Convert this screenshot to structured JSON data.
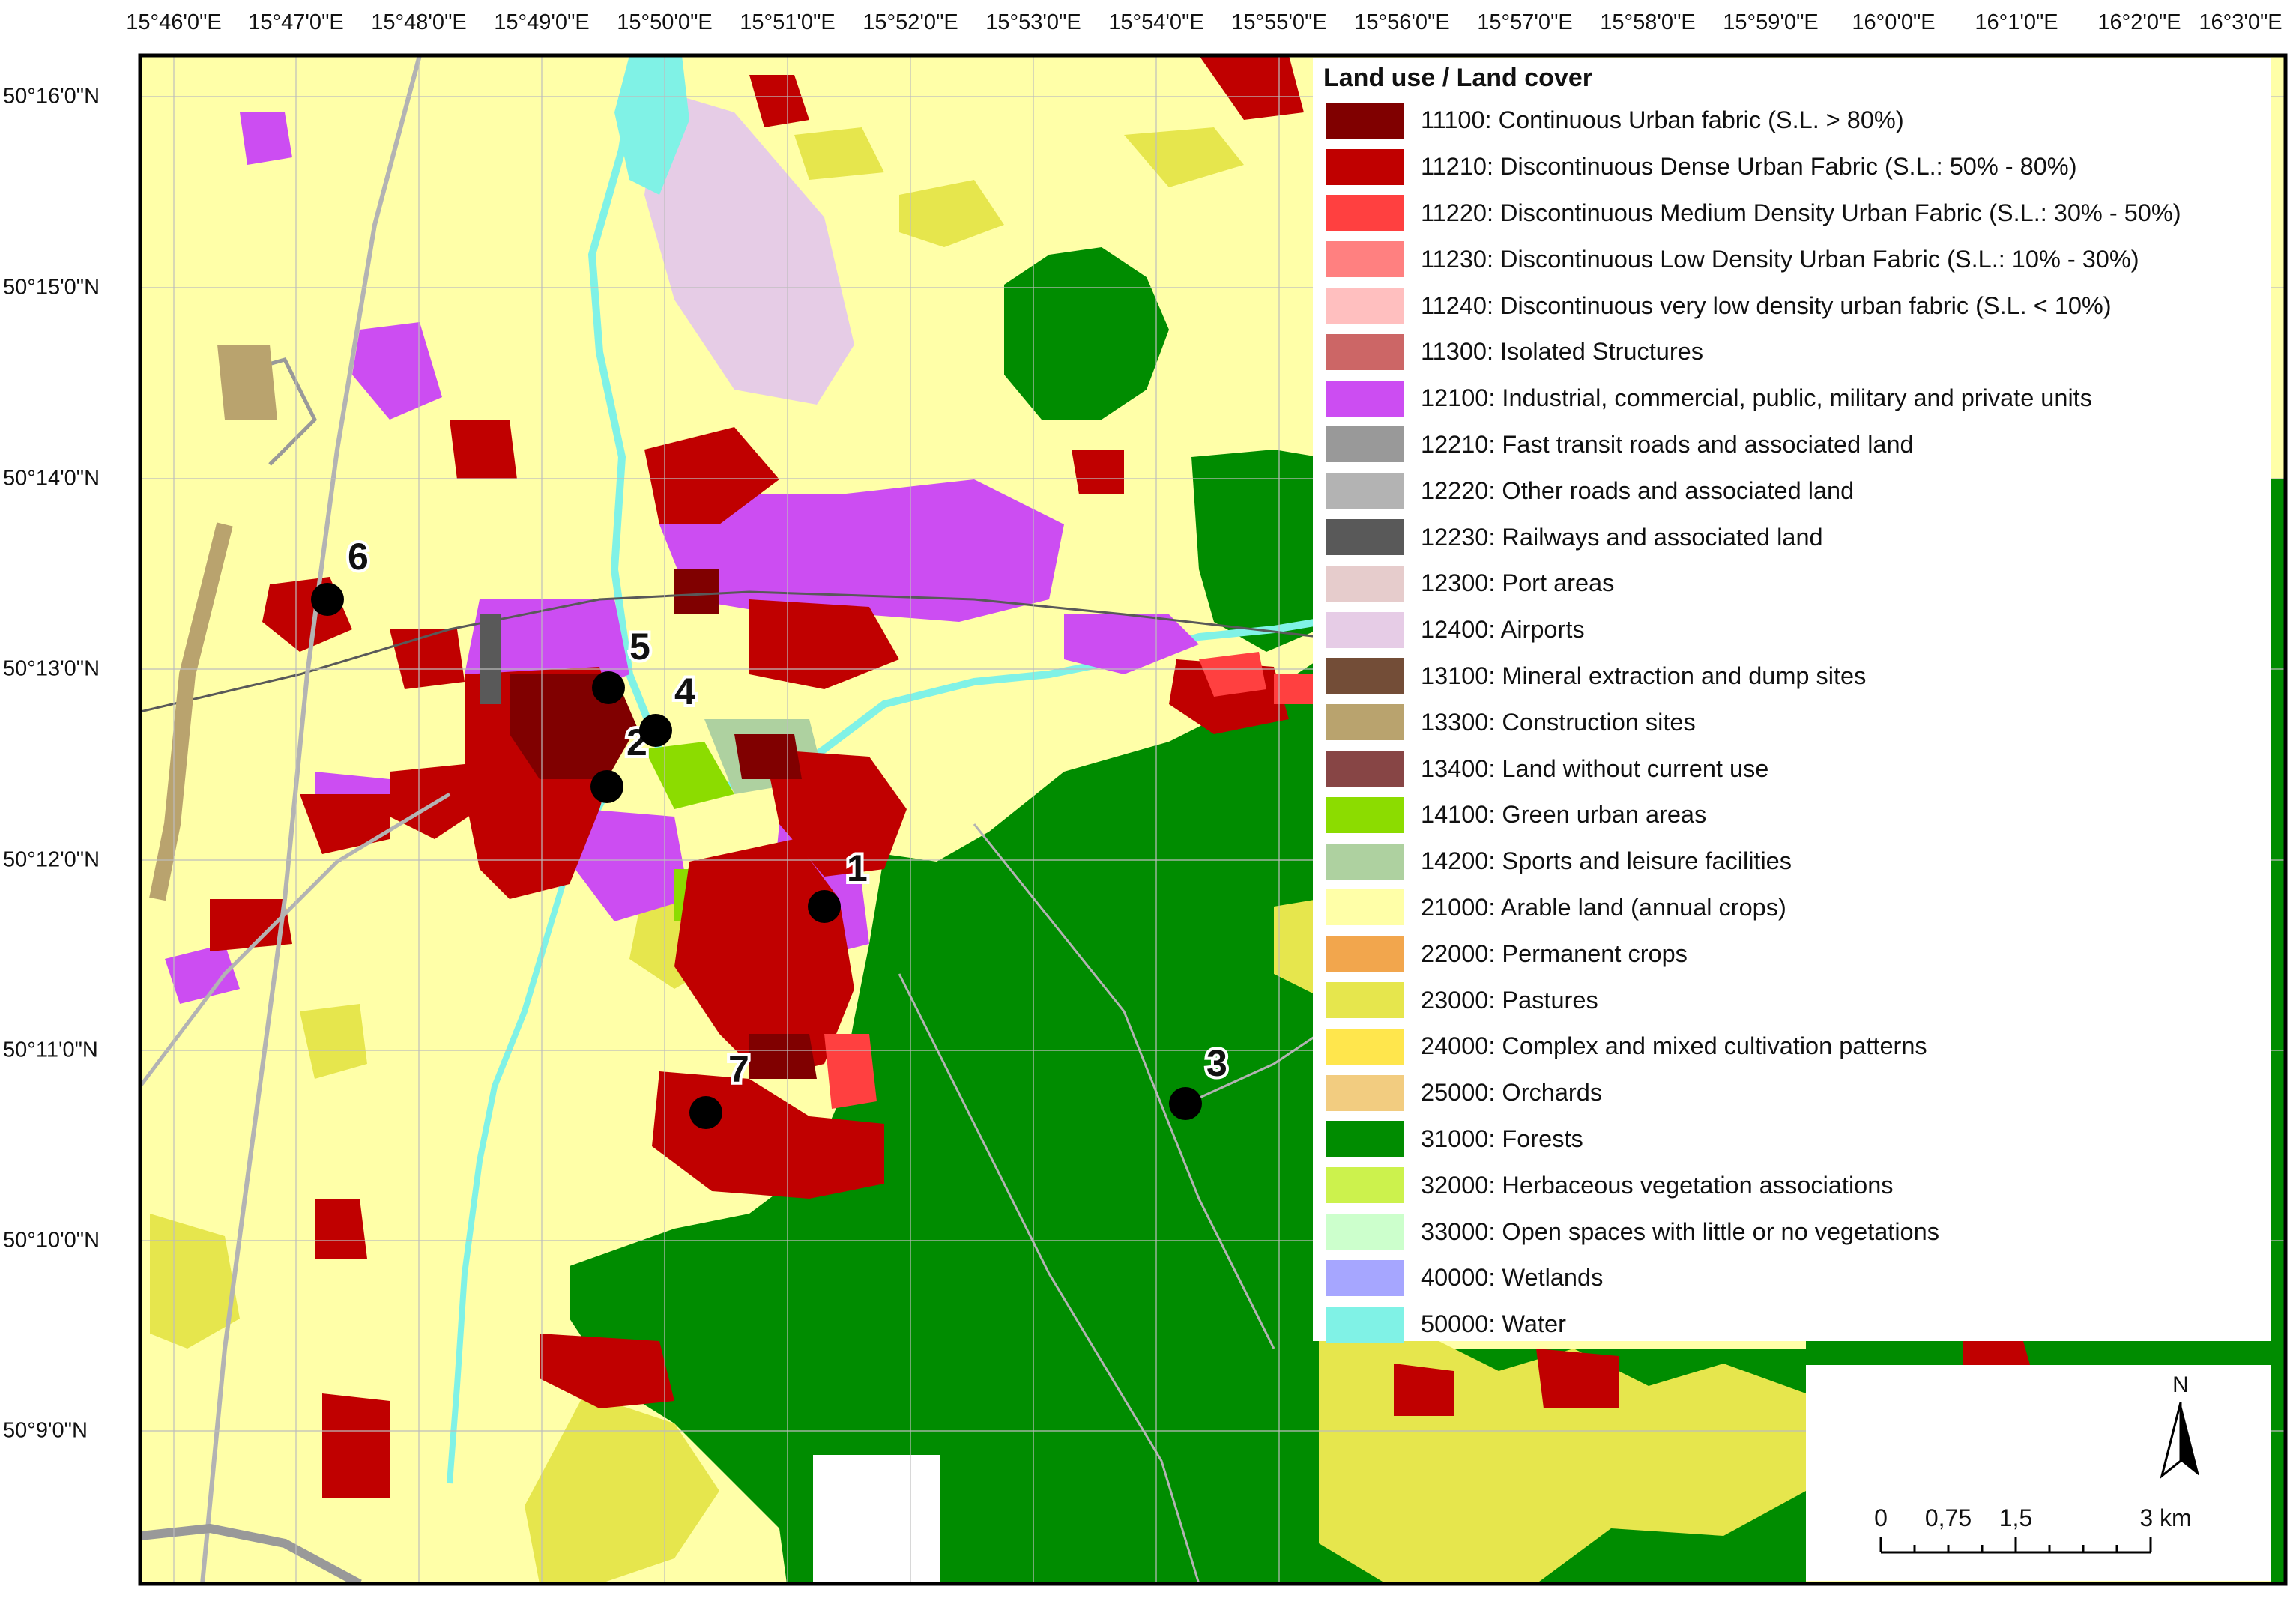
{
  "colors": {
    "arable": "#ffffa8",
    "forest": "#008c00",
    "continuous_urban": "#800000",
    "dense_urban": "#c00000",
    "medium_urban": "#ff4040",
    "low_urban": "#ff8080",
    "very_low_urban": "#ffbfbf",
    "isolated": "#cc6666",
    "industrial": "#cc4df2",
    "fast_roads": "#999999",
    "other_roads": "#b3b3b3",
    "railways": "#595959",
    "airport": "#e6cce6",
    "mineral": "#734d37",
    "construction": "#b9a36e",
    "green_urban": "#8cdc00",
    "sports": "#aed1a0",
    "pastures": "#e6e64d",
    "wetlands": "#a6a6ff",
    "water": "#80f2e6",
    "frame": "#000000",
    "point": "#000000"
  },
  "axes": {
    "top_ticks": [
      "15°46'0\"E",
      "15°47'0\"E",
      "15°48'0\"E",
      "15°49'0\"E",
      "15°50'0\"E",
      "15°51'0\"E",
      "15°52'0\"E",
      "15°53'0\"E",
      "15°54'0\"E",
      "15°55'0\"E",
      "15°56'0\"E",
      "15°57'0\"E",
      "15°58'0\"E",
      "15°59'0\"E",
      "16°0'0\"E",
      "16°1'0\"E",
      "16°2'0\"E",
      "16°3'0\"E"
    ],
    "left_ticks": [
      "50°16'0\"N",
      "50°15'0\"N",
      "50°14'0\"N",
      "50°13'0\"N",
      "50°12'0\"N",
      "50°11'0\"N",
      "50°10'0\"N",
      "50°9'0\"N"
    ]
  },
  "legend": {
    "title": "Land use / Land cover",
    "items": [
      {
        "label": "11100: Continuous Urban fabric (S.L. > 80%)",
        "color": "#800000"
      },
      {
        "label": "11210: Discontinuous Dense Urban Fabric (S.L.: 50% - 80%)",
        "color": "#c00000"
      },
      {
        "label": "11220: Discontinuous Medium Density Urban Fabric (S.L.: 30% - 50%)",
        "color": "#ff4040"
      },
      {
        "label": "11230: Discontinuous Low Density Urban Fabric (S.L.: 10% - 30%)",
        "color": "#ff8080"
      },
      {
        "label": "11240: Discontinuous very low density urban fabric (S.L. < 10%)",
        "color": "#ffbfbf"
      },
      {
        "label": "11300: Isolated Structures",
        "color": "#cc6666"
      },
      {
        "label": "12100: Industrial, commercial, public, military and private units",
        "color": "#cc4df2"
      },
      {
        "label": "12210: Fast transit roads and associated land",
        "color": "#999999"
      },
      {
        "label": "12220: Other roads and associated land",
        "color": "#b3b3b3"
      },
      {
        "label": "12230: Railways and associated land",
        "color": "#595959"
      },
      {
        "label": "12300: Port areas",
        "color": "#e6cccc"
      },
      {
        "label": "12400: Airports",
        "color": "#e6cce6"
      },
      {
        "label": "13100: Mineral extraction and dump sites",
        "color": "#734d37"
      },
      {
        "label": "13300: Construction sites",
        "color": "#b9a36e"
      },
      {
        "label": "13400: Land without current use",
        "color": "#874545"
      },
      {
        "label": "14100: Green urban areas",
        "color": "#8cdc00"
      },
      {
        "label": "14200: Sports and leisure facilities",
        "color": "#aed1a0"
      },
      {
        "label": "21000: Arable land (annual crops)",
        "color": "#ffffa8"
      },
      {
        "label": "22000: Permanent crops",
        "color": "#f2a64d"
      },
      {
        "label": "23000: Pastures",
        "color": "#e6e64d"
      },
      {
        "label": "24000: Complex and mixed cultivation patterns",
        "color": "#ffe64d"
      },
      {
        "label": "25000: Orchards",
        "color": "#f2cc80"
      },
      {
        "label": "31000: Forests",
        "color": "#008c00"
      },
      {
        "label": "32000: Herbaceous vegetation associations",
        "color": "#ccf24d"
      },
      {
        "label": "33000: Open spaces with little or no vegetations",
        "color": "#ccffcc"
      },
      {
        "label": "40000: Wetlands",
        "color": "#a6a6ff"
      },
      {
        "label": "50000: Water",
        "color": "#80f2e6"
      }
    ]
  },
  "scale_bar": {
    "north": "N",
    "labels": [
      "0",
      "0,75",
      "1,5",
      "3 km"
    ]
  },
  "sites": [
    {
      "id": "1",
      "label": "1"
    },
    {
      "id": "2",
      "label": "2"
    },
    {
      "id": "3",
      "label": "3"
    },
    {
      "id": "4",
      "label": "4"
    },
    {
      "id": "5",
      "label": "5"
    },
    {
      "id": "6",
      "label": "6"
    },
    {
      "id": "7",
      "label": "7"
    }
  ]
}
